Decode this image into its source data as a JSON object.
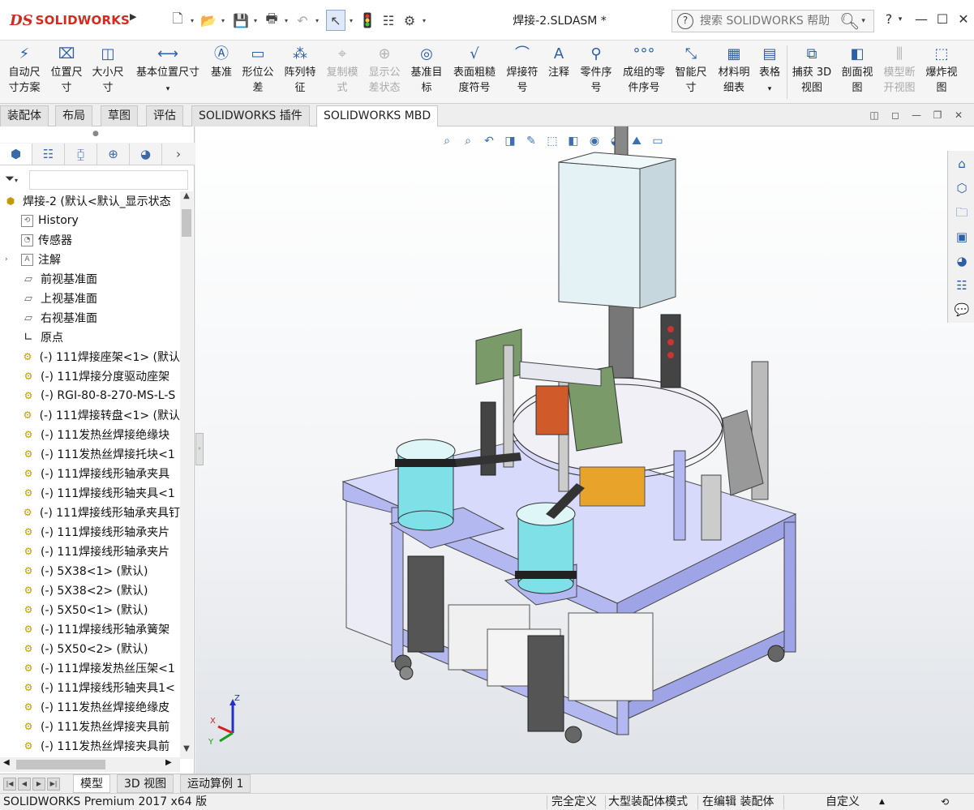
{
  "app": {
    "logo_prefix": "DS",
    "logo_name": "SOLIDWORKS",
    "document_title": "焊接-2.SLDASM *"
  },
  "search": {
    "placeholder": "搜索 SOLIDWORKS 帮助"
  },
  "title_controls": {
    "help": "?",
    "minimize": "—",
    "maximize": "☐",
    "close": "✕"
  },
  "ribbon": {
    "items": [
      {
        "label1": "自动尺",
        "label2": "寸方案",
        "icon": "auto-dimension-icon",
        "enabled": true
      },
      {
        "label1": "位置尺",
        "label2": "寸",
        "icon": "location-dimension-icon",
        "enabled": true
      },
      {
        "label1": "大小尺",
        "label2": "寸",
        "icon": "size-dimension-icon",
        "enabled": true
      },
      {
        "label1": "基本位置尺寸",
        "label2": "",
        "icon": "basic-location-dimension-icon",
        "enabled": true
      },
      {
        "label1": "基准",
        "label2": "",
        "icon": "datum-icon",
        "enabled": true
      },
      {
        "label1": "形位公",
        "label2": "差",
        "icon": "geometric-tolerance-icon",
        "enabled": true
      },
      {
        "label1": "阵列特",
        "label2": "征",
        "icon": "pattern-feature-icon",
        "enabled": true
      },
      {
        "label1": "复制模",
        "label2": "式",
        "icon": "copy-scheme-icon",
        "enabled": false
      },
      {
        "label1": "显示公",
        "label2": "差状态",
        "icon": "show-tolerance-status-icon",
        "enabled": false
      },
      {
        "label1": "基准目",
        "label2": "标",
        "icon": "datum-target-icon",
        "enabled": true
      },
      {
        "label1": "表面粗糙",
        "label2": "度符号",
        "icon": "surface-finish-icon",
        "enabled": true
      },
      {
        "label1": "焊接符",
        "label2": "号",
        "icon": "weld-symbol-icon",
        "enabled": true
      },
      {
        "label1": "注释",
        "label2": "",
        "icon": "note-icon",
        "enabled": true
      },
      {
        "label1": "零件序",
        "label2": "号",
        "icon": "balloon-icon",
        "enabled": true
      },
      {
        "label1": "成组的零",
        "label2": "件序号",
        "icon": "stacked-balloon-icon",
        "enabled": true
      },
      {
        "label1": "智能尺",
        "label2": "寸",
        "icon": "smart-dimension-icon",
        "enabled": true
      },
      {
        "label1": "材料明",
        "label2": "细表",
        "icon": "bom-icon",
        "enabled": true
      },
      {
        "label1": "表格",
        "label2": "",
        "icon": "table-icon",
        "enabled": true
      },
      {
        "label1": "捕获 3D",
        "label2": "视图",
        "icon": "capture-3d-view-icon",
        "enabled": true
      },
      {
        "label1": "剖面视",
        "label2": "图",
        "icon": "section-view-icon",
        "enabled": true
      },
      {
        "label1": "模型断",
        "label2": "开视图",
        "icon": "model-break-view-icon",
        "enabled": false
      },
      {
        "label1": "爆炸视",
        "label2": "图",
        "icon": "exploded-view-icon",
        "enabled": true
      }
    ]
  },
  "tabs": [
    "装配体",
    "布局",
    "草图",
    "评估",
    "SOLIDWORKS 插件",
    "SOLIDWORKS MBD"
  ],
  "active_tab": "SOLIDWORKS MBD",
  "tree": {
    "root": "焊接-2  (默认<默认_显示状态",
    "items": [
      {
        "label": "History",
        "icon": "history-icon",
        "expander": ""
      },
      {
        "label": "传感器",
        "icon": "sensor-icon",
        "expander": ""
      },
      {
        "label": "注解",
        "icon": "annotation-icon",
        "expander": "›"
      },
      {
        "label": "前视基准面",
        "icon": "plane-icon",
        "expander": ""
      },
      {
        "label": "上视基准面",
        "icon": "plane-icon",
        "expander": ""
      },
      {
        "label": "右视基准面",
        "icon": "plane-icon",
        "expander": ""
      },
      {
        "label": "原点",
        "icon": "origin-icon",
        "expander": ""
      },
      {
        "label": "(-) 111焊接座架<1> (默认",
        "icon": "component-icon",
        "expander": ""
      },
      {
        "label": "(-) 111焊接分度驱动座架",
        "icon": "component-icon",
        "expander": ""
      },
      {
        "label": "(-) RGI-80-8-270-MS-L-S",
        "icon": "component-icon",
        "expander": ""
      },
      {
        "label": "(-) 111焊接转盘<1> (默认",
        "icon": "component-icon",
        "expander": ""
      },
      {
        "label": "(-) 111发热丝焊接绝缘块",
        "icon": "component-icon",
        "expander": ""
      },
      {
        "label": "(-) 111发热丝焊接托块<1",
        "icon": "component-icon",
        "expander": ""
      },
      {
        "label": "(-) 111焊接线形轴承夹具",
        "icon": "component-icon",
        "expander": ""
      },
      {
        "label": "(-) 111焊接线形轴夹具<1",
        "icon": "component-icon",
        "expander": ""
      },
      {
        "label": "(-) 111焊接线形轴承夹具钉",
        "icon": "component-icon",
        "expander": ""
      },
      {
        "label": "(-) 111焊接线形轴承夹片",
        "icon": "component-icon",
        "expander": ""
      },
      {
        "label": "(-) 111焊接线形轴承夹片",
        "icon": "component-icon",
        "expander": ""
      },
      {
        "label": "(-) 5X38<1> (默认)",
        "icon": "component-icon",
        "expander": ""
      },
      {
        "label": "(-) 5X38<2> (默认)",
        "icon": "component-icon",
        "expander": ""
      },
      {
        "label": "(-) 5X50<1> (默认)",
        "icon": "component-icon",
        "expander": ""
      },
      {
        "label": "(-) 111焊接线形轴承簧架",
        "icon": "component-icon",
        "expander": ""
      },
      {
        "label": "(-) 5X50<2> (默认)",
        "icon": "component-icon",
        "expander": ""
      },
      {
        "label": "(-) 111焊接发热丝压架<1",
        "icon": "component-icon",
        "expander": ""
      },
      {
        "label": "(-) 111焊接线形轴夹具1<",
        "icon": "component-icon",
        "expander": ""
      },
      {
        "label": "(-) 111发热丝焊接绝缘皮",
        "icon": "component-icon",
        "expander": ""
      },
      {
        "label": "(-) 111发热丝焊接夹具前",
        "icon": "component-icon",
        "expander": ""
      },
      {
        "label": "(-) 111发热丝焊接夹具前",
        "icon": "component-icon",
        "expander": ""
      }
    ]
  },
  "triad": {
    "x": "X",
    "y": "Y",
    "z": "Z"
  },
  "bottom_tabs": [
    "模型",
    "3D 视图",
    "运动算例 1"
  ],
  "active_bottom_tab": "模型",
  "status": {
    "product": "SOLIDWORKS Premium 2017 x64 版",
    "definition": "完全定义",
    "mode": "大型装配体模式",
    "editing": "在编辑 装配体",
    "units": "自定义"
  },
  "colors": {
    "brand_red": "#d52b1e",
    "frame_purple": "#b3b8f0",
    "bowl_cyan": "#7fe0e8",
    "box_green": "#7a9a6a"
  }
}
